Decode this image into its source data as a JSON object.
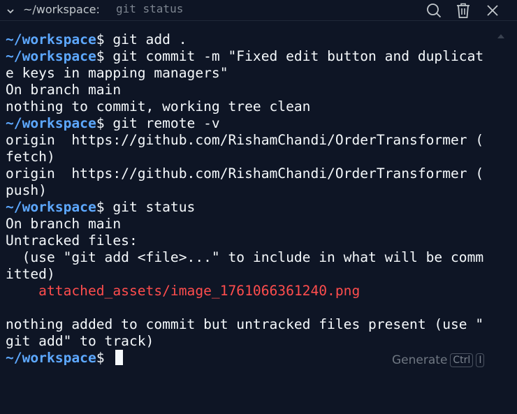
{
  "titlebar": {
    "path": "~/workspace:",
    "command": "git status",
    "icons": [
      "chevron-down-icon",
      "search-icon",
      "trash-icon",
      "close-icon"
    ]
  },
  "terminal": {
    "lines": [
      {
        "type": "prompt",
        "prompt": "~/workspace",
        "sign": "$",
        "text": " git add ."
      },
      {
        "type": "prompt",
        "prompt": "~/workspace",
        "sign": "$",
        "text": " git commit -m \"Fixed edit button and duplicat"
      },
      {
        "type": "output",
        "text": "e keys in mapping managers\""
      },
      {
        "type": "output",
        "text": "On branch main"
      },
      {
        "type": "output",
        "text": "nothing to commit, working tree clean"
      },
      {
        "type": "prompt",
        "prompt": "~/workspace",
        "sign": "$",
        "text": " git remote -v"
      },
      {
        "type": "output",
        "text": "origin  https://github.com/RishamChandi/OrderTransformer ("
      },
      {
        "type": "output",
        "text": "fetch)"
      },
      {
        "type": "output",
        "text": "origin  https://github.com/RishamChandi/OrderTransformer ("
      },
      {
        "type": "output",
        "text": "push)"
      },
      {
        "type": "prompt",
        "prompt": "~/workspace",
        "sign": "$",
        "text": " git status"
      },
      {
        "type": "output",
        "text": "On branch main"
      },
      {
        "type": "output",
        "text": "Untracked files:"
      },
      {
        "type": "output",
        "text": "  (use \"git add <file>...\" to include in what will be comm"
      },
      {
        "type": "output",
        "text": "itted)"
      },
      {
        "type": "untracked",
        "text": "    attached_assets/image_1761066361240.png"
      },
      {
        "type": "output",
        "text": ""
      },
      {
        "type": "output",
        "text": "nothing added to commit but untracked files present (use \""
      },
      {
        "type": "output",
        "text": "git add\" to track)"
      },
      {
        "type": "prompt-current",
        "prompt": "~/workspace",
        "sign": "$",
        "text": " "
      }
    ]
  },
  "generate": {
    "label": "Generate",
    "shortcut_key1": "Ctrl",
    "shortcut_key2": "I"
  },
  "colors": {
    "background": "#0e1525",
    "prompt": "#5da8ff",
    "text": "#f5f9fc",
    "untracked": "#ff4d4d",
    "muted": "#7d8590"
  }
}
